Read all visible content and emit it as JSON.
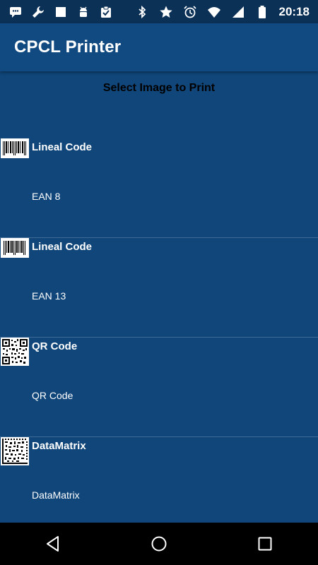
{
  "status_bar": {
    "left_icons": [
      "message-icon",
      "wrench-icon",
      "square-icon",
      "android-debug-icon",
      "clipboard-icon"
    ],
    "right_icons": [
      "bluetooth-icon",
      "star-icon",
      "alarm-icon",
      "wifi-icon",
      "signal-icon",
      "battery-icon"
    ],
    "time": "20:18"
  },
  "app_bar": {
    "title": "CPCL Printer",
    "color": "#114a80"
  },
  "page": {
    "subtitle": "Select Image to Print",
    "background": "#10467a"
  },
  "items": [
    {
      "title": "Lineal Code",
      "subtitle": "EAN 8",
      "thumbnail": "barcode-ean8-icon"
    },
    {
      "title": "Lineal Code",
      "subtitle": "EAN 13",
      "thumbnail": "barcode-ean13-icon"
    },
    {
      "title": "QR Code",
      "subtitle": "QR Code",
      "thumbnail": "qr-code-icon"
    },
    {
      "title": "DataMatrix",
      "subtitle": "DataMatrix",
      "thumbnail": "datamatrix-icon"
    }
  ],
  "nav_bar": {
    "buttons": [
      "back-icon",
      "home-icon",
      "recents-icon"
    ]
  }
}
